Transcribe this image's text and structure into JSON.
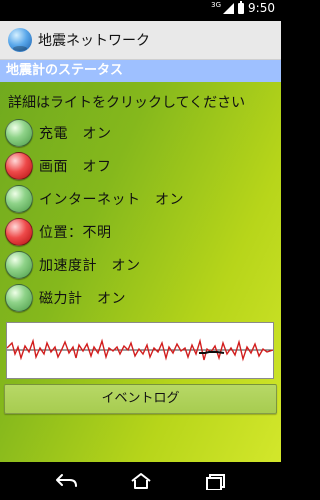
{
  "status_bar": {
    "network": "3G",
    "time": "9:50"
  },
  "app": {
    "title": "地震ネットワーク"
  },
  "section": {
    "header": "地震計のステータス",
    "instruction": "詳細はライトをクリックしてください"
  },
  "statuses": [
    {
      "label": "充電　オン",
      "state": "on",
      "color": "green"
    },
    {
      "label": "画面　オフ",
      "state": "off",
      "color": "red"
    },
    {
      "label": "インターネット　オン",
      "state": "on",
      "color": "green"
    },
    {
      "label": "位置：不明",
      "state": "unknown",
      "color": "red"
    },
    {
      "label": "加速度計　オン",
      "state": "on",
      "color": "green"
    },
    {
      "label": "磁力計　オン",
      "state": "on",
      "color": "green"
    }
  ],
  "button": {
    "event_log": "イベントログ"
  },
  "colors": {
    "header_blue": "#9ec0ff",
    "graph_line": "#d21d1d"
  },
  "icons": {
    "app": "globe-icon",
    "back": "back-icon",
    "home": "home-icon",
    "recent": "recent-apps-icon"
  }
}
